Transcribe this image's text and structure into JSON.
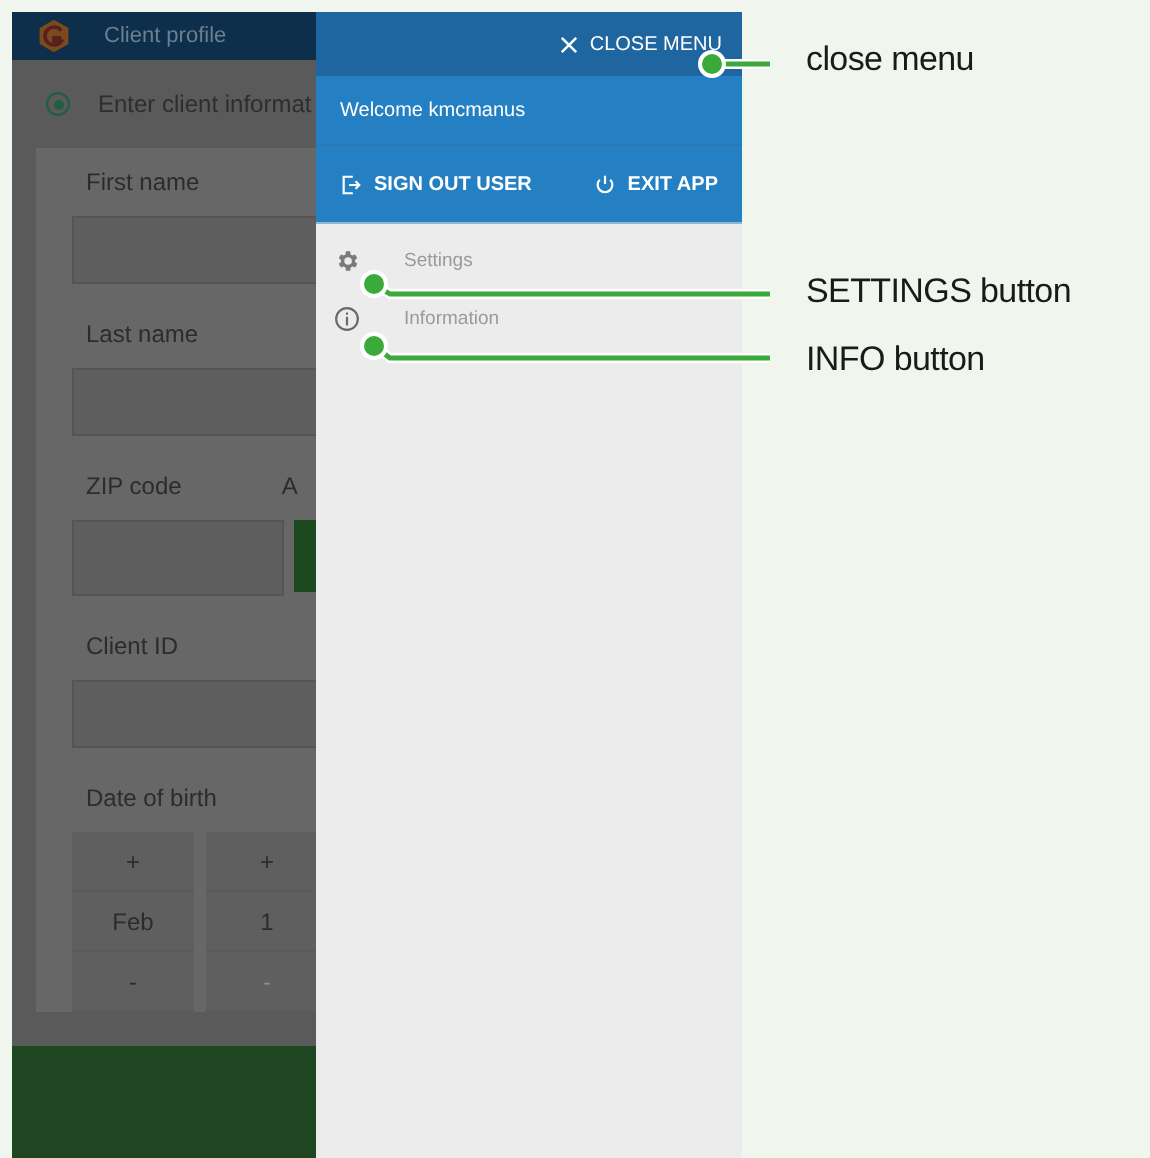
{
  "app_header": {
    "title": "Client profile"
  },
  "form": {
    "mode": {
      "label": "Enter client informat",
      "selected": true
    },
    "fields": [
      {
        "kind": "text",
        "label": "First name"
      },
      {
        "kind": "text",
        "label": "Last name"
      },
      {
        "kind": "zip",
        "label": "ZIP code",
        "side_label": "A"
      },
      {
        "kind": "text",
        "label": "Client ID"
      },
      {
        "kind": "date",
        "label": "Date of birth",
        "columns": [
          {
            "plus": "+",
            "value": "Feb",
            "minus": "-",
            "disabled": false
          },
          {
            "plus": "+",
            "value": "1",
            "minus": "-",
            "disabled": true
          }
        ]
      }
    ]
  },
  "drawer": {
    "close": "CLOSE MENU",
    "welcome": "Welcome kmcmanus",
    "actions": [
      {
        "kind": "sign_out",
        "label": "SIGN OUT USER"
      },
      {
        "kind": "exit",
        "label": "EXIT APP"
      }
    ],
    "items": [
      {
        "kind": "settings",
        "label": "Settings"
      },
      {
        "kind": "info",
        "label": "Information"
      }
    ]
  },
  "annotations": [
    "close menu",
    "SETTINGS button",
    "INFO button"
  ]
}
